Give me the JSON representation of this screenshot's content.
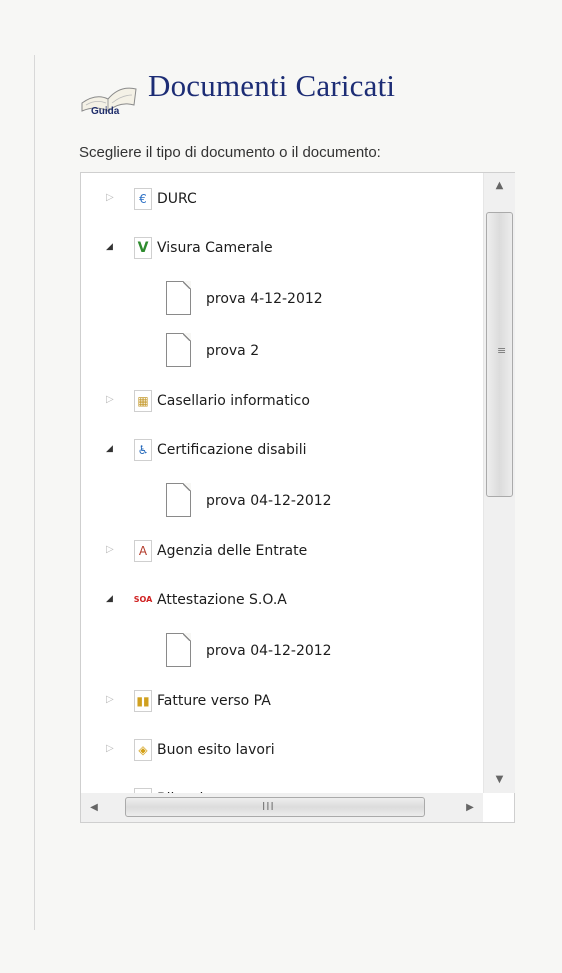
{
  "header": {
    "guide_label": "Guida",
    "title": "Documenti Caricati",
    "instruction": "Scegliere il tipo di documento o il documento:"
  },
  "tree": {
    "items": [
      {
        "label": "DURC",
        "expanded": false,
        "icon": "euro-icon",
        "icon_glyph": "€",
        "icon_color": "#2b6fc4"
      },
      {
        "label": "Visura Camerale",
        "expanded": true,
        "icon": "check-v-icon",
        "icon_glyph": "V",
        "icon_color": "#2e8b2e"
      },
      {
        "label": "prova 4-12-2012",
        "type": "document"
      },
      {
        "label": "prova 2",
        "type": "document"
      },
      {
        "label": "Casellario informatico",
        "expanded": false,
        "icon": "archive-icon",
        "icon_glyph": "▦",
        "icon_color": "#c59a2e"
      },
      {
        "label": "Certificazione disabili",
        "expanded": true,
        "icon": "wheelchair-icon",
        "icon_glyph": "♿",
        "icon_color": "#1d63b8"
      },
      {
        "label": "prova 04-12-2012",
        "type": "document"
      },
      {
        "label": "Agenzia delle Entrate",
        "expanded": false,
        "icon": "agency-icon",
        "icon_glyph": "A",
        "icon_color": "#b23a2a"
      },
      {
        "label": "Attestazione S.O.A",
        "expanded": true,
        "icon": "soa-icon",
        "icon_glyph": "SOA",
        "icon_color": "#d02020"
      },
      {
        "label": "prova 04-12-2012",
        "type": "document"
      },
      {
        "label": "Fatture verso PA",
        "expanded": false,
        "icon": "invoice-icon",
        "icon_glyph": "▮▮",
        "icon_color": "#d0a020"
      },
      {
        "label": "Buon esito lavori",
        "expanded": false,
        "icon": "diamond-icon",
        "icon_glyph": "◈",
        "icon_color": "#d4a017"
      },
      {
        "label": "Bilancio",
        "expanded": false,
        "icon": "chart-icon",
        "icon_glyph": "◪",
        "icon_color": "#5a7fb0"
      }
    ]
  },
  "scrollbars": {
    "up": "▲",
    "down": "▼",
    "left": "◀",
    "right": "▶",
    "v_grip": "≡",
    "h_grip": "III"
  }
}
